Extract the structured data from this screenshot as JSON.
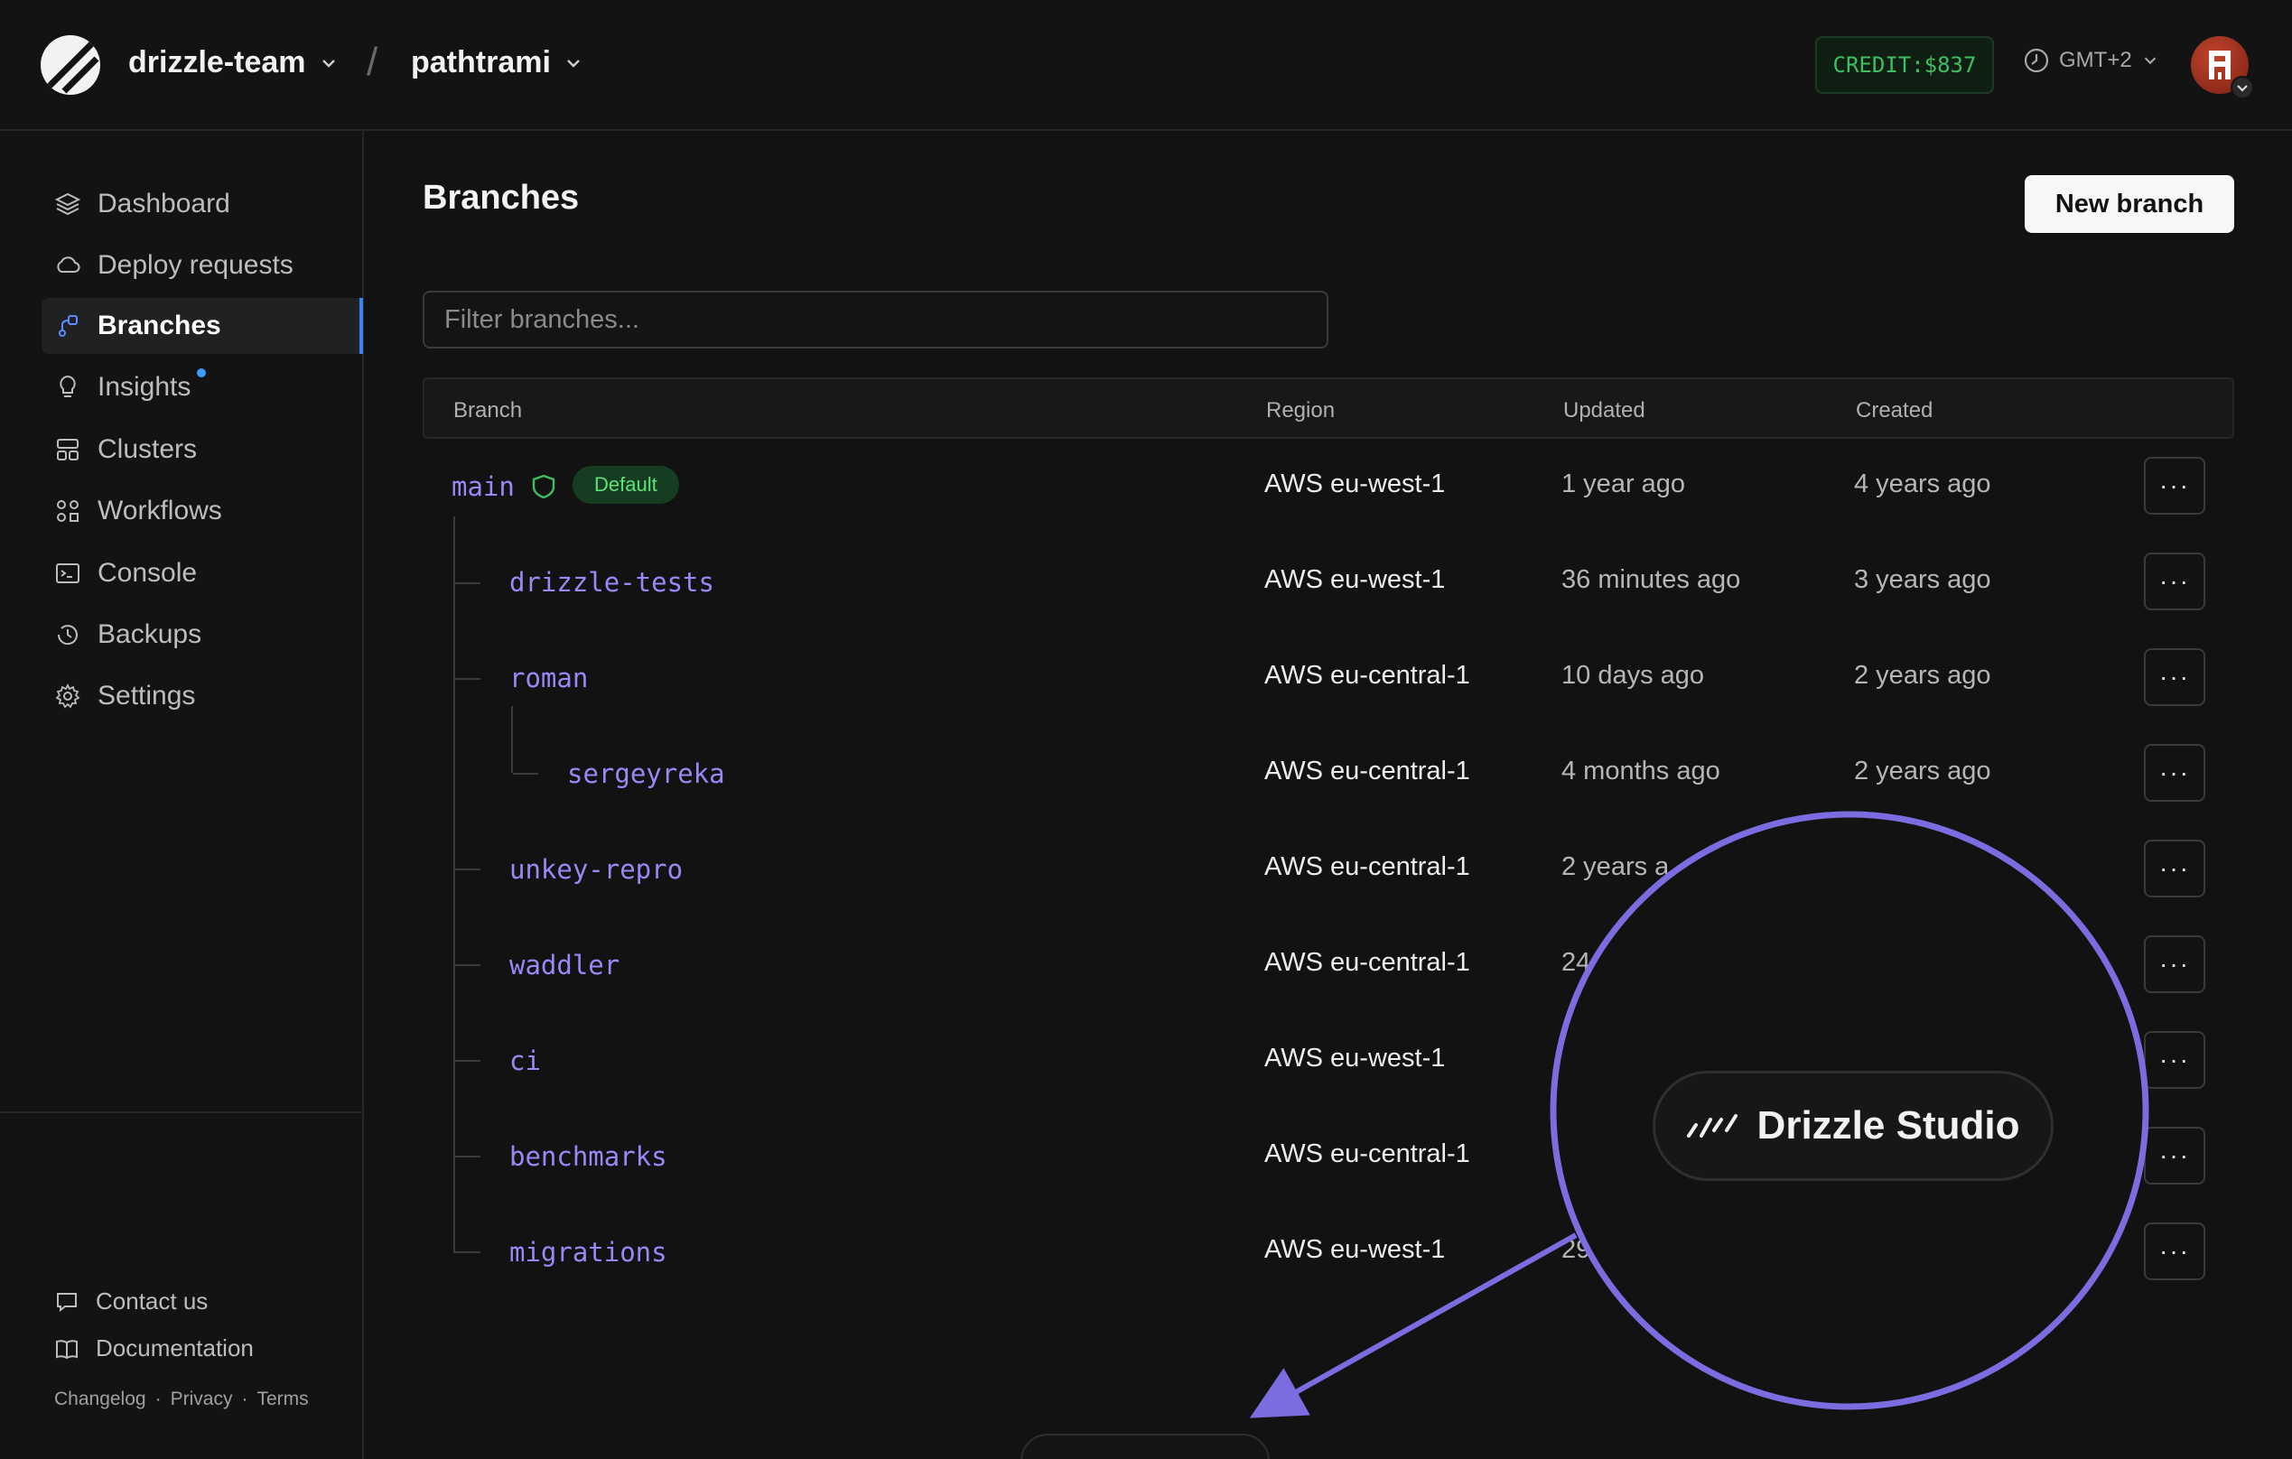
{
  "header": {
    "org": "drizzle-team",
    "separator": "/",
    "database": "pathtrami",
    "credit": "CREDIT:$837",
    "timezone": "GMT+2"
  },
  "sidebar": {
    "items": [
      {
        "label": "Dashboard",
        "icon": "layers-icon"
      },
      {
        "label": "Deploy requests",
        "icon": "cloud-icon"
      },
      {
        "label": "Branches",
        "icon": "branch-icon",
        "active": true
      },
      {
        "label": "Insights",
        "icon": "lightbulb-icon",
        "notification": true
      },
      {
        "label": "Clusters",
        "icon": "cluster-icon"
      },
      {
        "label": "Workflows",
        "icon": "workflow-icon"
      },
      {
        "label": "Console",
        "icon": "terminal-icon"
      },
      {
        "label": "Backups",
        "icon": "history-icon"
      },
      {
        "label": "Settings",
        "icon": "gear-icon"
      }
    ],
    "footer": {
      "contact": "Contact us",
      "docs": "Documentation",
      "links": [
        "Changelog",
        "Privacy",
        "Terms"
      ],
      "link_separator": "·"
    }
  },
  "main": {
    "title": "Branches",
    "new_branch_label": "New branch",
    "filter_placeholder": "Filter branches...",
    "columns": [
      "Branch",
      "Region",
      "Updated",
      "Created"
    ],
    "default_badge": "Default",
    "more_label": "···",
    "rows": [
      {
        "name": "main",
        "region": "AWS eu-west-1",
        "updated": "1 year ago",
        "created": "4 years ago"
      },
      {
        "name": "drizzle-tests",
        "region": "AWS eu-west-1",
        "updated": "36 minutes ago",
        "created": "3 years ago"
      },
      {
        "name": "roman",
        "region": "AWS eu-central-1",
        "updated": "10 days ago",
        "created": "2 years ago"
      },
      {
        "name": "sergeyreka",
        "region": "AWS eu-central-1",
        "updated": "4 months ago",
        "created": "2 years ago"
      },
      {
        "name": "unkey-repro",
        "region": "AWS eu-central-1",
        "updated": "2 years a",
        "created": ""
      },
      {
        "name": "waddler",
        "region": "AWS eu-central-1",
        "updated": "24",
        "created": ""
      },
      {
        "name": "ci",
        "region": "AWS eu-west-1",
        "updated": "",
        "created": ""
      },
      {
        "name": "benchmarks",
        "region": "AWS eu-central-1",
        "updated": "",
        "created": ""
      },
      {
        "name": "migrations",
        "region": "AWS eu-west-1",
        "updated": "29",
        "created": ""
      }
    ]
  },
  "overlay": {
    "studio_label": "Drizzle Studio",
    "accent": "#7b6ce0"
  }
}
